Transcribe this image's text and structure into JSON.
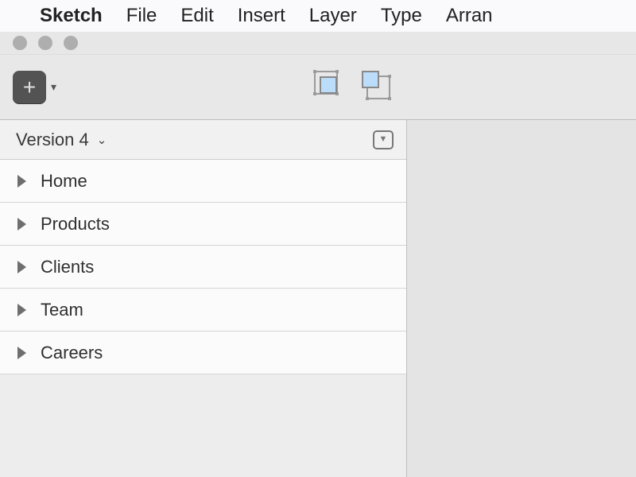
{
  "menubar": {
    "app": "Sketch",
    "items": [
      "File",
      "Edit",
      "Insert",
      "Layer",
      "Type",
      "Arran"
    ]
  },
  "panel": {
    "version": "Version 4",
    "pages": [
      "Home",
      "Products",
      "Clients",
      "Team",
      "Careers"
    ]
  }
}
